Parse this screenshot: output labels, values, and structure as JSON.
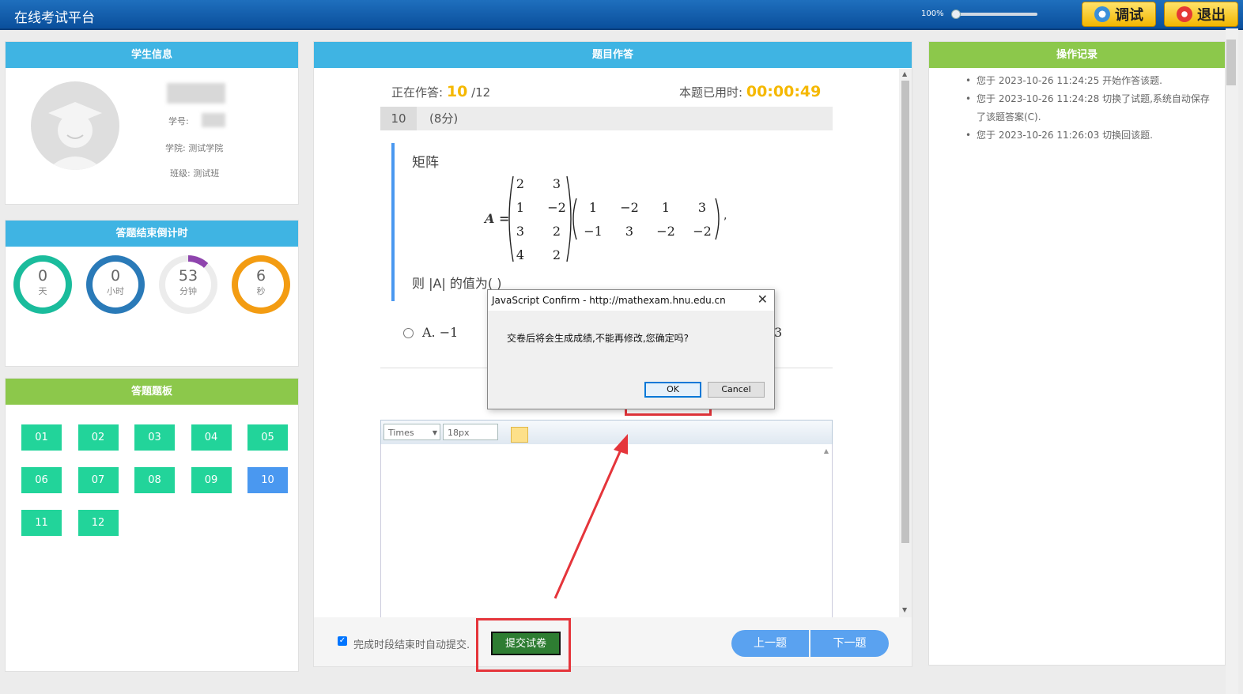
{
  "app": {
    "title": "在线考试平台",
    "zoom": "100%",
    "zoom_value": 0.0,
    "debug_label": "调试",
    "logout_label": "退出"
  },
  "student": {
    "header": "学生信息",
    "id_label": "学号:",
    "college": "学院: 测试学院",
    "class": "班级: 测试班"
  },
  "countdown": {
    "header": "答题结束倒计时",
    "items": [
      {
        "value": "0",
        "unit": "天",
        "color": "#1abc9c",
        "fraction": 1.0
      },
      {
        "value": "0",
        "unit": "小时",
        "color": "#2a7ab8",
        "fraction": 1.0
      },
      {
        "value": "53",
        "unit": "分钟",
        "color": "#8e44ad",
        "fraction": 0.12
      },
      {
        "value": "6",
        "unit": "秒",
        "color": "#f39c12",
        "fraction": 1.0
      }
    ]
  },
  "board": {
    "header": "答题题板",
    "questions": [
      "01",
      "02",
      "03",
      "04",
      "05",
      "06",
      "07",
      "08",
      "09",
      "10",
      "11",
      "12"
    ],
    "current": "10"
  },
  "question": {
    "header": "题目作答",
    "progress_label": "正在作答:",
    "current": "10",
    "total": "/12",
    "timer_label": "本题已用时:",
    "timer": "00:00:49",
    "number": "10",
    "score": "(8分)",
    "stem_title": "矩阵",
    "matrix_label": "A",
    "matrix1": [
      [
        "2",
        "3"
      ],
      [
        "1",
        "−2"
      ],
      [
        "3",
        "2"
      ],
      [
        "4",
        "2"
      ]
    ],
    "matrix2": [
      [
        "1",
        "−2",
        "1",
        "3"
      ],
      [
        "−1",
        "3",
        "−2",
        "−2"
      ]
    ],
    "tail": "则 |A| 的值为(   )",
    "option_a": "A. −1",
    "option_partial": "3"
  },
  "editor": {
    "font": "Times",
    "size": "18px"
  },
  "footer": {
    "auto_submit_label": "完成时段结束时自动提交.",
    "submit_label": "提交试卷",
    "prev_label": "上一题",
    "next_label": "下一题"
  },
  "log": {
    "header": "操作记录",
    "items": [
      "您于 2023-10-26  11:24:25 开始作答该题.",
      "您于 2023-10-26  11:24:28 切换了试题,系统自动保存了该题答案(C).",
      "您于 2023-10-26  11:26:03 切换回该题."
    ]
  },
  "dialog": {
    "title": "JavaScript Confirm - http://mathexam.hnu.edu.cn",
    "message": "交卷后将会生成成绩,不能再修改,您确定吗?",
    "ok": "OK",
    "cancel": "Cancel"
  }
}
